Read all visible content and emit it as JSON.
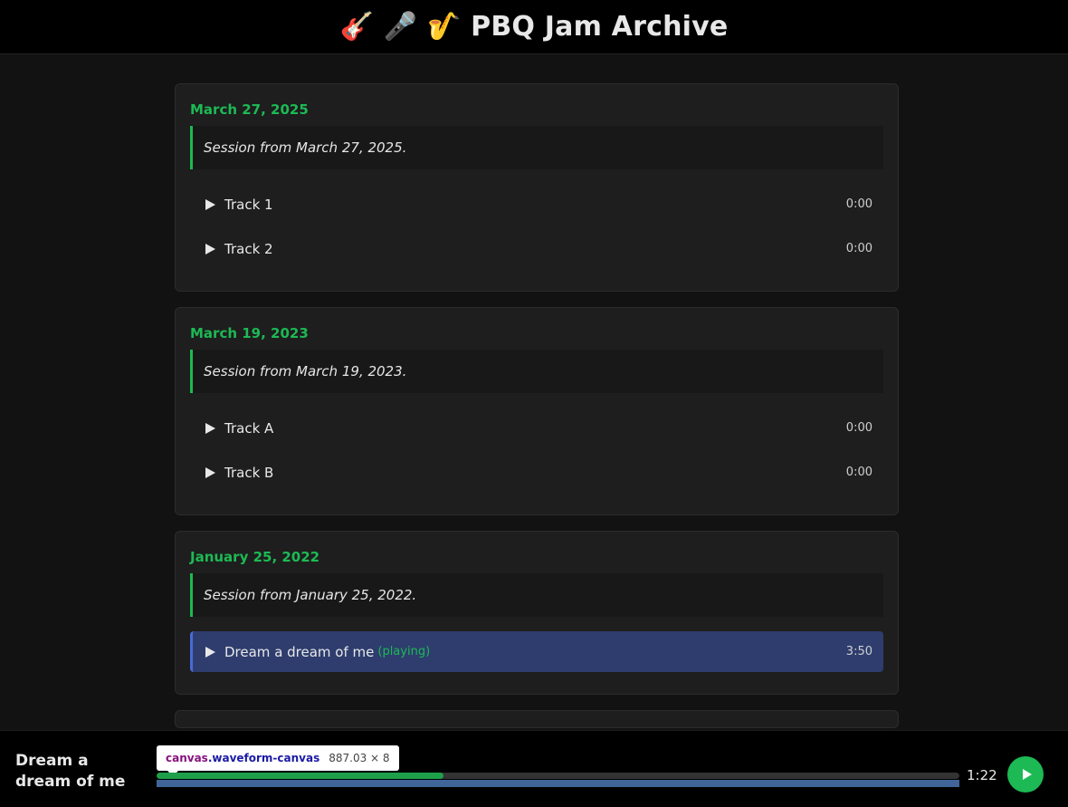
{
  "header": {
    "title": "🎸 🎤 🎷 PBQ Jam Archive"
  },
  "sessions": [
    {
      "date": "March 27, 2025",
      "note": "Session from March 27, 2025.",
      "tracks": [
        {
          "title": "Track 1",
          "duration": "0:00",
          "playing_label": ""
        },
        {
          "title": "Track 2",
          "duration": "0:00",
          "playing_label": ""
        }
      ]
    },
    {
      "date": "March 19, 2023",
      "note": "Session from March 19, 2023.",
      "tracks": [
        {
          "title": "Track A",
          "duration": "0:00",
          "playing_label": ""
        },
        {
          "title": "Track B",
          "duration": "0:00",
          "playing_label": ""
        }
      ]
    },
    {
      "date": "January 25, 2022",
      "note": "Session from January 25, 2022.",
      "tracks": [
        {
          "title": "Dream a dream of me",
          "duration": "3:50",
          "playing_label": "(playing)"
        }
      ]
    }
  ],
  "player": {
    "now_playing": "Dream a dream of me",
    "current_time": "1:22",
    "progress_fraction": 0.357,
    "tooltip": {
      "tag": "canvas",
      "class": ".waveform-canvas",
      "size": "887.03 × 8"
    }
  },
  "colors": {
    "accent": "#1db954",
    "active_track_bg": "#2e3d6e",
    "active_track_border": "#4a6ad8"
  },
  "icons": {
    "track_play": "play-icon",
    "player_play": "play-circle-icon"
  }
}
